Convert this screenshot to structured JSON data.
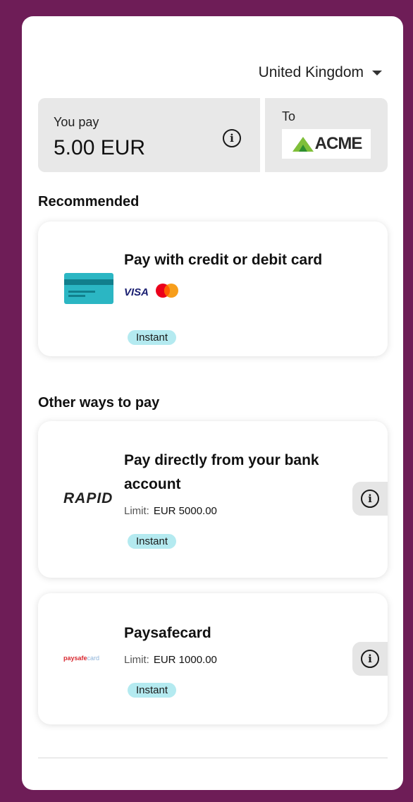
{
  "country": {
    "selected": "United Kingdom"
  },
  "payment": {
    "label": "You pay",
    "amount": "5.00 EUR",
    "to_label": "To",
    "merchant_logo_text": "ACME"
  },
  "sections": {
    "recommended": "Recommended",
    "other": "Other ways to pay"
  },
  "methods": [
    {
      "title": "Pay with credit or debit card",
      "brands": [
        "VISA"
      ],
      "badge": "Instant"
    },
    {
      "title_line1": "Pay directly from your bank",
      "title_line2": "account",
      "logo_text": "RAPID",
      "limit_label": "Limit:",
      "limit_value": "EUR 5000.00",
      "badge": "Instant"
    },
    {
      "title": "Paysafecard",
      "logo_text": "paysafe",
      "logo_text_light": "card",
      "limit_label": "Limit:",
      "limit_value": "EUR 1000.00",
      "badge": "Instant"
    }
  ],
  "icons": {
    "info": "i"
  },
  "colors": {
    "background": "#6e1d57",
    "badge": "#b4eaf0",
    "card_icon": "#2bb6c3"
  }
}
